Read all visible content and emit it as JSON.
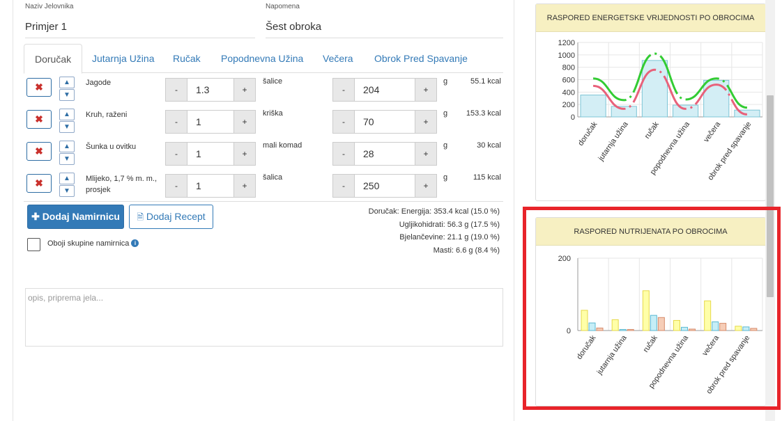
{
  "diet": {
    "name_label": "Naziv Jelovnika",
    "name_value": "Primjer 1",
    "note_label": "Napomena",
    "note_value": "Šest obroka"
  },
  "tabs": [
    "Doručak",
    "Jutarnja Užina",
    "Ručak",
    "Popodnevna Užina",
    "Večera",
    "Obrok Pred Spavanje"
  ],
  "active_tab": "Doručak",
  "foods": [
    {
      "name": "Jagode",
      "qty": "1.3",
      "unit": "šalice",
      "grams": "204",
      "g_unit": "g",
      "kcal": "55.1 kcal"
    },
    {
      "name": "Kruh, raženi",
      "qty": "1",
      "unit": "kriška",
      "grams": "70",
      "g_unit": "g",
      "kcal": "153.3 kcal"
    },
    {
      "name": "Šunka u ovitku",
      "qty": "1",
      "unit": "mali komad",
      "grams": "28",
      "g_unit": "g",
      "kcal": "30 kcal"
    },
    {
      "name": "Mlijeko, 1,7 % m. m., prosjek",
      "qty": "1",
      "unit": "šalica",
      "grams": "250",
      "g_unit": "g",
      "kcal": "115 kcal"
    }
  ],
  "buttons": {
    "delete": "✖",
    "up": "▲",
    "down": "▼",
    "minus": "-",
    "plus": "+",
    "add_food": "Dodaj Namirnicu",
    "add_recipe": "Dodaj Recept"
  },
  "icons": {
    "add": "plus-icon",
    "recipe": "document-icon",
    "info": "info-icon"
  },
  "color_groups_label": "Oboji skupine namirnica",
  "summary": [
    "Doručak: Energija: 353.4 kcal (15.0 %)",
    "Ugljikohidrati: 56.3 g (17.5 %)",
    "Bjelančevine: 21.1 g (19.0 %)",
    "Masti: 6.6 g (8.4 %)"
  ],
  "description_placeholder": "opis, priprema jela...",
  "colors": {
    "primary": "#337ab7",
    "danger": "#c9302c",
    "card_header": "#f7f0c2",
    "highlight": "#e8242a"
  },
  "chart_data": [
    {
      "type": "bar",
      "title": "RASPORED ENERGETSKE VRIJEDNOSTI PO OBROCIMA",
      "categories": [
        "doručak",
        "jutarnja užina",
        "ručak",
        "popodnevna užina",
        "večera",
        "obrok pred spavanje"
      ],
      "values": [
        353,
        170,
        910,
        190,
        590,
        110
      ],
      "line_upper": [
        620,
        270,
        1020,
        280,
        620,
        150
      ],
      "line_lower": [
        500,
        130,
        760,
        130,
        520,
        40
      ],
      "yticks": [
        0,
        200,
        400,
        600,
        800,
        1000,
        1200
      ],
      "ylim": [
        0,
        1200
      ],
      "colors": {
        "bar": "#d3eef5",
        "bar_stroke": "#7dc5d6",
        "upper": "#33cc33",
        "lower": "#e8617a"
      }
    },
    {
      "type": "bar",
      "title": "RASPORED NUTRIJENATA PO OBROCIMA",
      "categories": [
        "doručak",
        "jutarnja užina",
        "ručak",
        "popodnevna užina",
        "večera",
        "obrok pred spavanje"
      ],
      "series": [
        {
          "values": [
            56,
            30,
            110,
            28,
            82,
            12
          ]
        },
        {
          "values": [
            21,
            3,
            42,
            9,
            24,
            10
          ]
        },
        {
          "values": [
            7,
            3,
            36,
            4,
            20,
            6
          ]
        }
      ],
      "yticks": [
        0,
        200
      ],
      "ylim": [
        0,
        200
      ],
      "colors": [
        "#ffffa8",
        "#c6eef7",
        "#f6cdb7"
      ],
      "strokes": [
        "#e6d94a",
        "#5ab8d0",
        "#d68a6a"
      ]
    }
  ]
}
